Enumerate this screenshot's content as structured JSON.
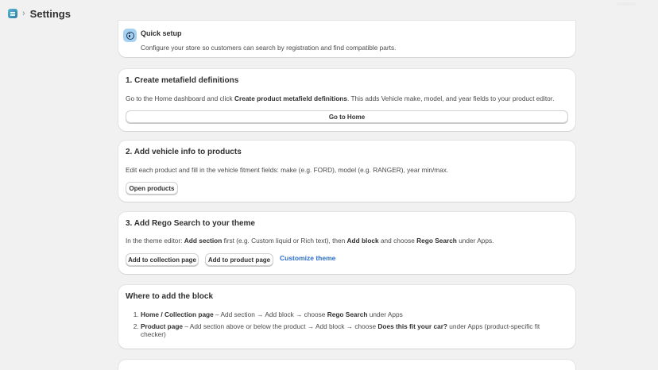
{
  "header": {
    "separator": "›",
    "title": "Settings"
  },
  "quick_setup": {
    "title": "Quick setup",
    "description": "Configure your store so customers can search by registration and find compatible parts."
  },
  "step1": {
    "title": "1. Create metafield definitions",
    "text_a": "Go to the Home dashboard and click ",
    "text_b": "Create product metafield definitions",
    "text_c": ". This adds Vehicle make, model, and year fields to your product editor.",
    "button": "Go to Home"
  },
  "step2": {
    "title": "2. Add vehicle info to products",
    "text": "Edit each product and fill in the vehicle fitment fields: make (e.g. FORD), model (e.g. RANGER), year min/max.",
    "button": "Open products"
  },
  "step3": {
    "title": "3. Add Rego Search to your theme",
    "text_a": "In the theme editor: ",
    "text_b": "Add section",
    "text_c": " first (e.g. Custom liquid or Rich text), then ",
    "text_d": "Add block",
    "text_e": " and choose ",
    "text_f": "Rego Search",
    "text_g": " under Apps.",
    "button_collection": "Add to collection page",
    "button_product": "Add to product page",
    "link_customize": "Customize theme"
  },
  "where": {
    "title": "Where to add the block",
    "items": [
      {
        "label": "Home / Collection page",
        "text_a": " – Add section → Add block → choose ",
        "bold": "Rego Search",
        "text_b": " under Apps",
        "text_c": ""
      },
      {
        "label": "Product page",
        "text_a": " – Add section above or below the product → Add block → choose ",
        "bold": "Does this fit your car?",
        "text_b": " under Apps (product-specific fit",
        "text_c": "checker)"
      }
    ]
  },
  "colors": {
    "background": "#f1f1f1",
    "card": "#ffffff",
    "link": "#2c6ecb",
    "info_badge": "#a7d1f1"
  },
  "icons": {
    "app": "app-logo-icon",
    "info": "info-icon"
  }
}
